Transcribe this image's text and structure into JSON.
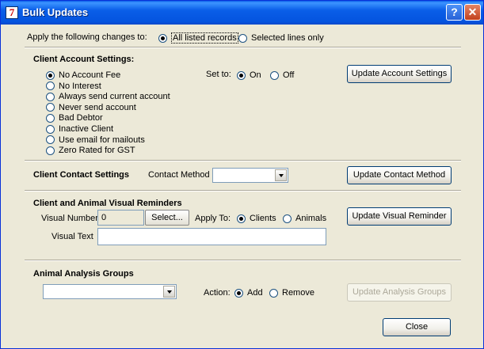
{
  "window": {
    "title": "Bulk Updates",
    "app_icon": "7",
    "help_glyph": "?",
    "close_glyph": "✕"
  },
  "apply": {
    "label": "Apply the following changes to:",
    "options": [
      "All listed records",
      "Selected lines only"
    ],
    "selected": 0
  },
  "account": {
    "heading": "Client Account Settings:",
    "options": [
      "No Account Fee",
      "No Interest",
      "Always send current account",
      "Never send account",
      "Bad Debtor",
      "Inactive Client",
      "Use email for mailouts",
      "Zero Rated for GST"
    ],
    "selected": 0,
    "set_to_label": "Set to:",
    "set_to_options": [
      "On",
      "Off"
    ],
    "set_to_selected": 0,
    "button": "Update Account Settings"
  },
  "contact": {
    "heading": "Client Contact Settings",
    "method_label": "Contact Method",
    "method_value": "",
    "button": "Update Contact Method"
  },
  "visual": {
    "heading": "Client and Animal Visual Reminders",
    "number_label": "Visual Number",
    "number_value": "0",
    "select_button": "Select...",
    "apply_to_label": "Apply To:",
    "apply_to_options": [
      "Clients",
      "Animals"
    ],
    "apply_to_selected": 0,
    "text_label": "Visual Text",
    "text_value": "",
    "button": "Update Visual Reminder"
  },
  "analysis": {
    "heading": "Animal Analysis Groups",
    "group_value": "",
    "action_label": "Action:",
    "action_options": [
      "Add",
      "Remove"
    ],
    "action_selected": 0,
    "button": "Update Analysis Groups",
    "button_enabled": false
  },
  "footer": {
    "close_button": "Close"
  }
}
